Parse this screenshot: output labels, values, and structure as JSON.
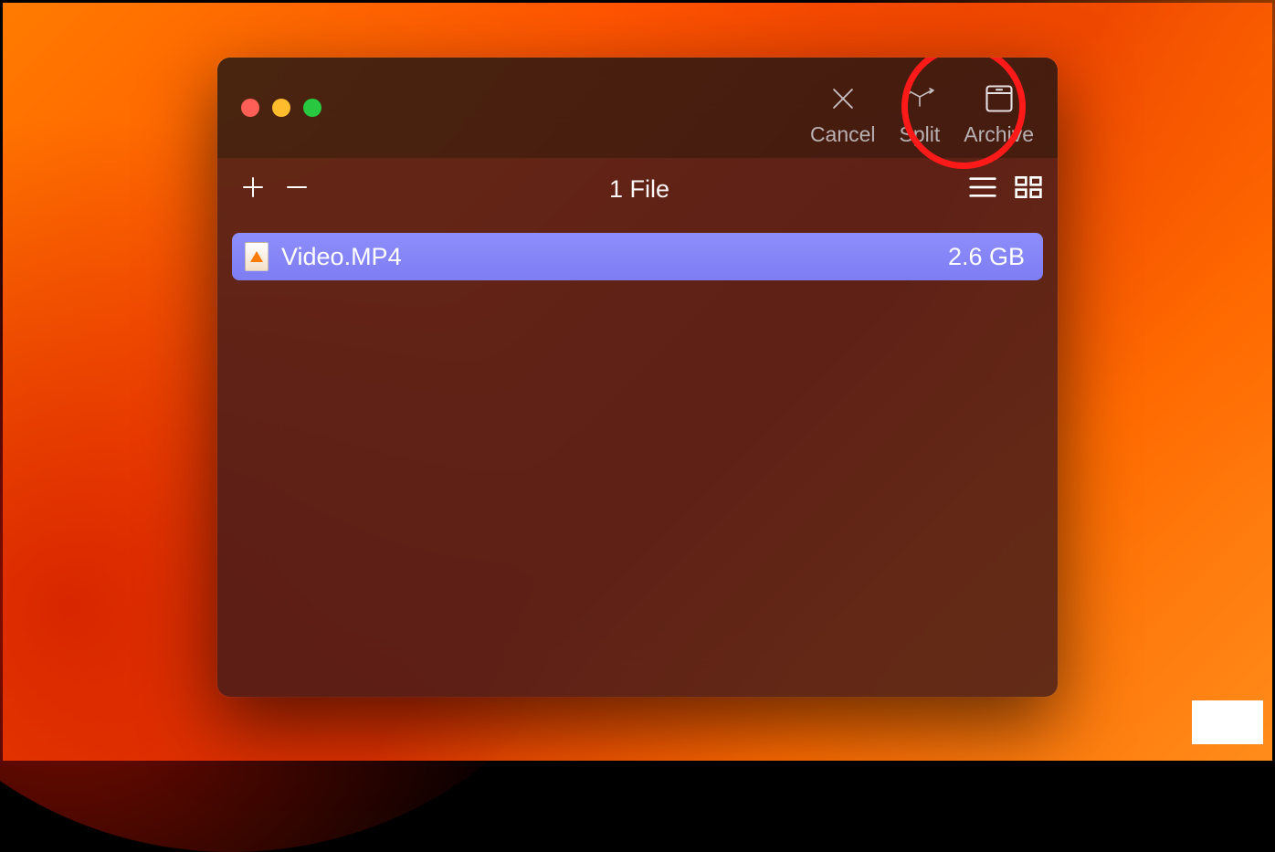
{
  "toolbar": {
    "cancel_label": "Cancel",
    "split_label": "Split",
    "archive_label": "Archive"
  },
  "subtoolbar": {
    "file_count": "1 File"
  },
  "files": [
    {
      "name": "Video.MP4",
      "size": "2.6 GB"
    }
  ]
}
